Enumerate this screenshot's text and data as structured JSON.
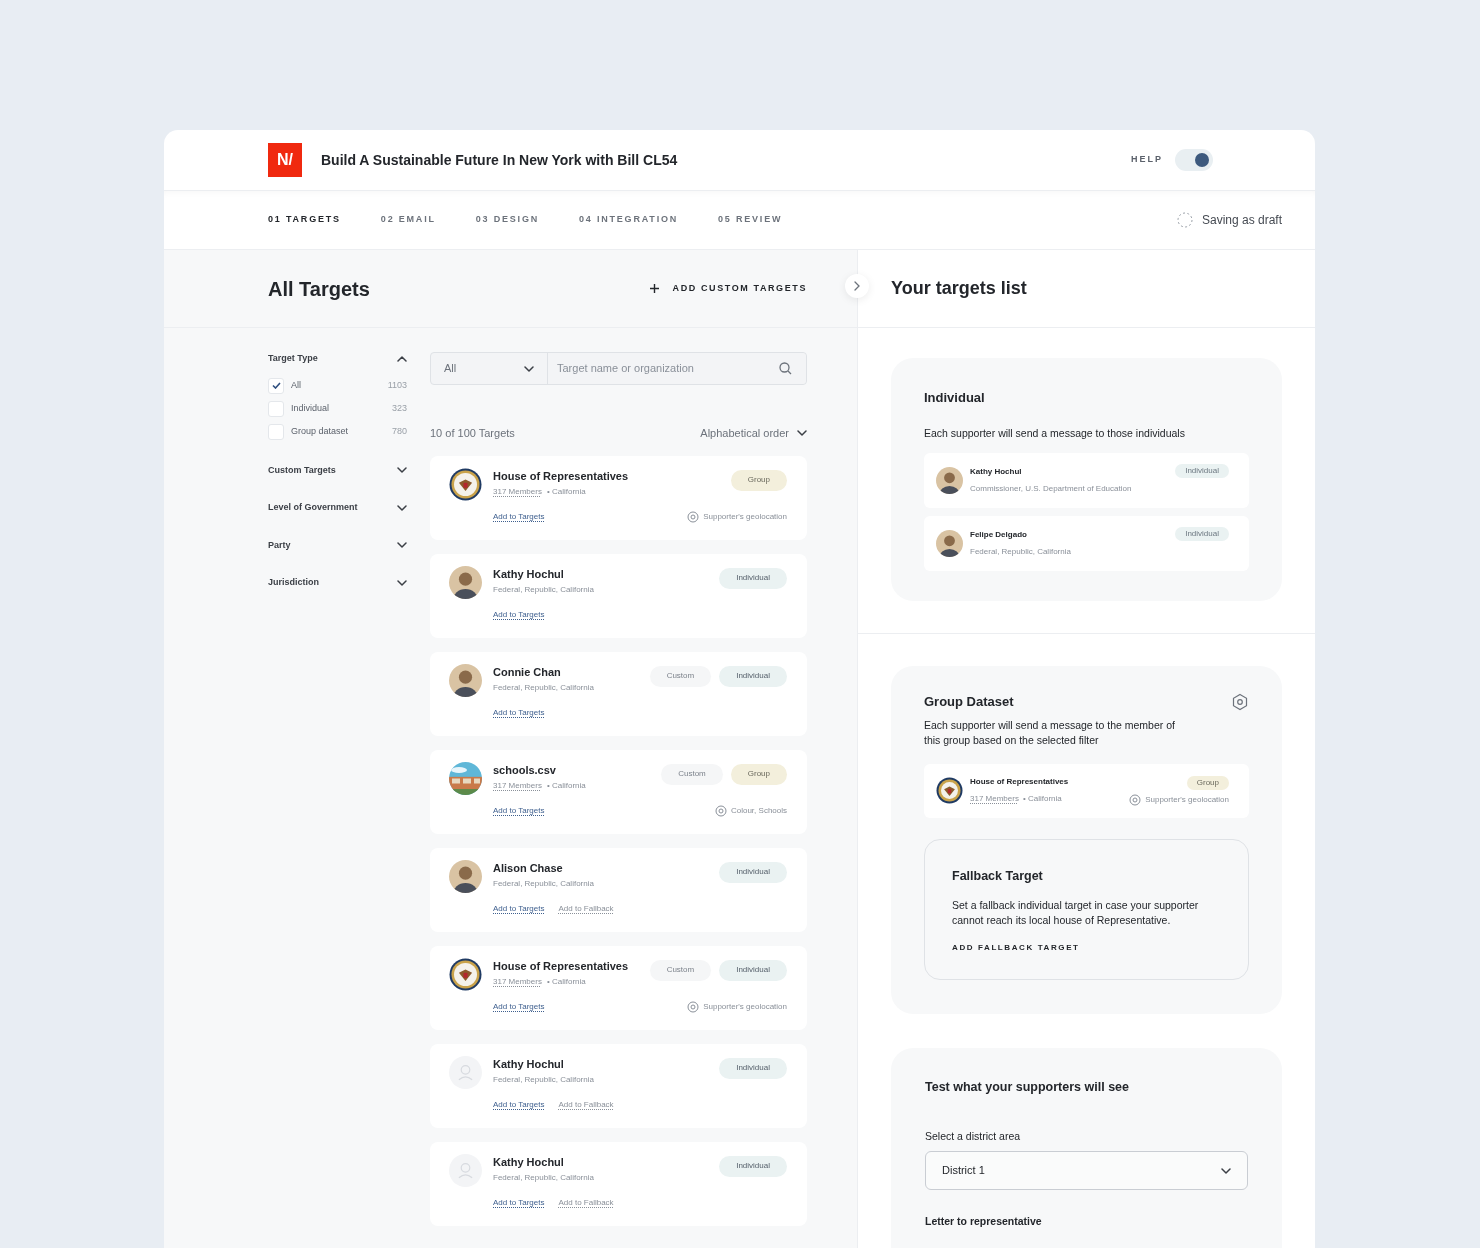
{
  "header": {
    "logo": "N/",
    "title": "Build A Sustainable Future In New York with Bill CL54",
    "help_label": "HELP",
    "help_on": true
  },
  "steps": [
    {
      "label": "01 TARGETS",
      "selected": true
    },
    {
      "label": "02 EMAIL",
      "selected": false
    },
    {
      "label": "03 DESIGN",
      "selected": false
    },
    {
      "label": "04 INTEGRATION",
      "selected": false
    },
    {
      "label": "05 REVIEW",
      "selected": false
    }
  ],
  "save_status": "Saving as draft",
  "left": {
    "title": "All Targets",
    "add_custom": "ADD CUSTOM TARGETS",
    "filters": [
      {
        "label": "Target Type",
        "expanded": true,
        "options": [
          {
            "label": "All",
            "count": "1103",
            "checked": true
          },
          {
            "label": "Individual",
            "count": "323",
            "checked": false
          },
          {
            "label": "Group dataset",
            "count": "780",
            "checked": false
          }
        ]
      },
      {
        "label": "Custom Targets",
        "expanded": false
      },
      {
        "label": "Level of Government",
        "expanded": false
      },
      {
        "label": "Party",
        "expanded": false
      },
      {
        "label": "Jurisdiction",
        "expanded": false
      }
    ],
    "type_select": "All",
    "search": {
      "placeholder": "Target name or organization"
    },
    "result_count": "10 of 100 Targets",
    "sort": "Alphabetical order",
    "targets": [
      {
        "avatar": {
          "kind": "seal"
        },
        "name": "House of Representatives",
        "members": "317 Members",
        "location": "• California",
        "tags": [
          {
            "kind": "group",
            "label": "Group"
          }
        ],
        "actions": [
          {
            "kind": "primary",
            "label": "Add to Targets"
          }
        ],
        "filter": "Supporter's geolocation"
      },
      {
        "avatar": {
          "kind": "person"
        },
        "name": "Kathy Hochul",
        "subtitle": "Federal, Republic, California",
        "tags": [
          {
            "kind": "individual",
            "label": "Individual"
          }
        ],
        "actions": [
          {
            "kind": "primary",
            "label": "Add to Targets"
          }
        ]
      },
      {
        "avatar": {
          "kind": "person"
        },
        "name": "Connie Chan",
        "subtitle": "Federal, Republic, California",
        "tags": [
          {
            "kind": "custom",
            "label": "Custom"
          },
          {
            "kind": "individual",
            "label": "Individual"
          }
        ],
        "actions": [
          {
            "kind": "primary",
            "label": "Add to Targets"
          }
        ]
      },
      {
        "avatar": {
          "kind": "picture"
        },
        "name": "schools.csv",
        "members": "317 Members",
        "location": "• California",
        "tags": [
          {
            "kind": "custom",
            "label": "Custom"
          },
          {
            "kind": "group",
            "label": "Group"
          }
        ],
        "actions": [
          {
            "kind": "primary",
            "label": "Add to Targets"
          }
        ],
        "filter": "Colour, Schools"
      },
      {
        "avatar": {
          "kind": "person"
        },
        "name": "Alison Chase",
        "subtitle": "Federal, Republic, California",
        "tags": [
          {
            "kind": "individual",
            "label": "Individual"
          }
        ],
        "actions": [
          {
            "kind": "primary",
            "label": "Add to Targets"
          },
          {
            "kind": "secondary",
            "label": "Add to Fallback"
          }
        ]
      },
      {
        "avatar": {
          "kind": "seal"
        },
        "name": "House of Representatives",
        "members": "317 Members",
        "location": "• California",
        "tags": [
          {
            "kind": "custom",
            "label": "Custom"
          },
          {
            "kind": "individual",
            "label": "Individual"
          }
        ],
        "actions": [
          {
            "kind": "primary",
            "label": "Add to Targets"
          }
        ],
        "filter": "Supporter's geolocation"
      },
      {
        "avatar": {
          "kind": "placeholder"
        },
        "name": "Kathy Hochul",
        "subtitle": "Federal, Republic, California",
        "tags": [
          {
            "kind": "individual",
            "label": "Individual"
          }
        ],
        "actions": [
          {
            "kind": "primary",
            "label": "Add to Targets"
          },
          {
            "kind": "secondary",
            "label": "Add to Fallback"
          }
        ]
      },
      {
        "avatar": {
          "kind": "placeholder"
        },
        "name": "Kathy Hochul",
        "subtitle": "Federal, Republic, California",
        "tags": [
          {
            "kind": "individual",
            "label": "Individual"
          }
        ],
        "actions": [
          {
            "kind": "primary",
            "label": "Add to Targets"
          },
          {
            "kind": "secondary",
            "label": "Add to Fallback"
          }
        ]
      }
    ]
  },
  "right": {
    "title": "Your targets list",
    "individual": {
      "title": "Individual",
      "description": "Each supporter will send a message to those individuals",
      "items": [
        {
          "avatar": {
            "kind": "person"
          },
          "name": "Kathy Hochul",
          "subtitle": "Commissioner, U.S. Department of Education",
          "tag": "Individual"
        },
        {
          "avatar": {
            "kind": "person"
          },
          "name": "Felipe Delgado",
          "subtitle": "Federal, Republic, California",
          "tag": "Individual"
        }
      ]
    },
    "group": {
      "title": "Group Dataset",
      "description": "Each supporter will send a message to the member of this group based on the selected filter",
      "item": {
        "avatar": {
          "kind": "seal"
        },
        "name": "House of Representatives",
        "members": "317 Members",
        "location": "• California",
        "tag": "Group",
        "filter": "Supporter's geolocation"
      },
      "fallback": {
        "title": "Fallback Target",
        "description": "Set a fallback individual target in case your supporter cannot reach its local house of Representative.",
        "action": "ADD FALLBACK TARGET"
      }
    },
    "test": {
      "title": "Test what your supporters will see",
      "district_label": "Select a district area",
      "district": "District 1",
      "letter_label": "Letter to representative"
    }
  }
}
